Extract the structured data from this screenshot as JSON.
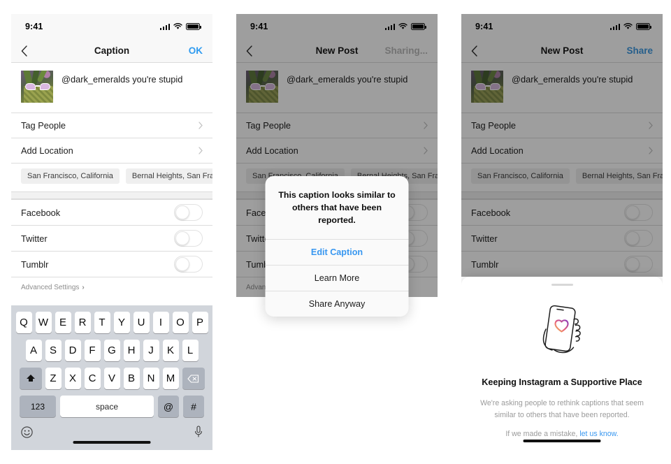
{
  "status_bar": {
    "time": "9:41",
    "signal_icon": "cellular-signal-icon",
    "wifi_icon": "wifi-icon",
    "battery_icon": "battery-icon"
  },
  "post": {
    "thumbnail_alt": "pineapple-with-sunglasses-thumbnail",
    "caption": "@dark_emeralds you're stupid"
  },
  "list": {
    "tag_people": "Tag People",
    "add_location": "Add Location",
    "location_chips": [
      "San Francisco, California",
      "Bernal Heights, San Fra"
    ],
    "facebook": "Facebook",
    "twitter": "Twitter",
    "tumblr": "Tumblr",
    "advanced_settings": "Advanced Settings",
    "advanced_arrow": "›"
  },
  "phone1": {
    "nav": {
      "back": "‹",
      "title": "Caption",
      "action": "OK"
    },
    "keyboard": {
      "row1": [
        "Q",
        "W",
        "E",
        "R",
        "T",
        "Y",
        "U",
        "I",
        "O",
        "P"
      ],
      "row2": [
        "A",
        "S",
        "D",
        "F",
        "G",
        "H",
        "J",
        "K",
        "L"
      ],
      "row3": [
        "Z",
        "X",
        "C",
        "V",
        "B",
        "N",
        "M"
      ],
      "shift_label": "shift-key",
      "delete_label": "backspace-key",
      "numbers": "123",
      "space": "space",
      "at": "@",
      "hash": "#",
      "emoji_icon": "emoji-smiley-icon",
      "mic_icon": "microphone-icon"
    }
  },
  "phone2": {
    "nav": {
      "back": "‹",
      "title": "New Post",
      "action": "Sharing..."
    },
    "alert": {
      "title": "This caption looks similar to others that have been reported.",
      "buttons": [
        "Edit Caption",
        "Learn More",
        "Share Anyway"
      ]
    }
  },
  "phone3": {
    "nav": {
      "back": "‹",
      "title": "New Post",
      "action": "Share"
    },
    "sheet": {
      "illustration": "hand-holding-phone-with-heart-icon",
      "heading": "Keeping Instagram a Supportive Place",
      "body": "We're asking people to rethink captions that seem similar to others that have been reported.",
      "footer_prefix": "If we made a mistake, ",
      "footer_link": "let us know."
    }
  },
  "colors": {
    "accent_blue": "#3897f0",
    "nav_blue": "#2f9bf0",
    "keyboard_bg": "#d1d5db",
    "key_white": "#ffffff",
    "key_gray": "#adb3bd",
    "muted_text": "#9b9b9b"
  }
}
